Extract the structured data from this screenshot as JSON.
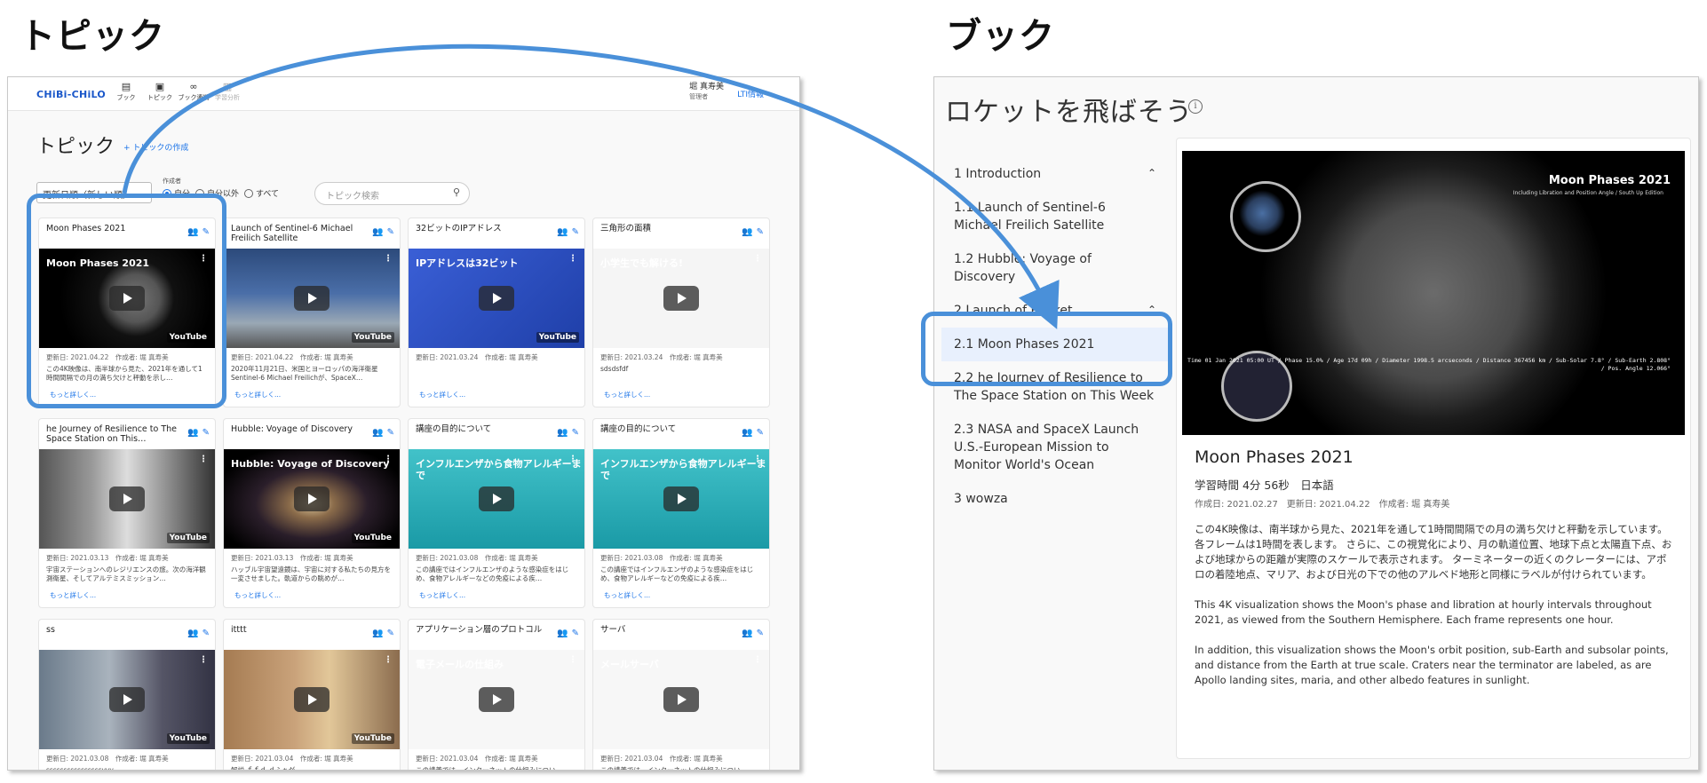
{
  "labels": {
    "left": "トピック",
    "right": "ブック"
  },
  "app": {
    "logo": "CHiBi-CHiLO",
    "nav": [
      {
        "label": "ブック",
        "icon": "book-icon"
      },
      {
        "label": "トピック",
        "icon": "topics-icon"
      },
      {
        "label": "ブック連携",
        "icon": "link-icon"
      },
      {
        "label": "学習分析",
        "icon": "chart-icon"
      }
    ],
    "user_name": "堀 真寿美",
    "user_role": "管理者",
    "lti": "LTI情報"
  },
  "topics_page": {
    "title": "トピック",
    "create": "+ トピックの作成",
    "sort": "更新日順（新しい順）",
    "creator_label": "作成者",
    "filters": [
      "自分",
      "自分以外",
      "すべて"
    ],
    "search_placeholder": "トピック検索",
    "more": "もっと詳しく...",
    "cards": [
      {
        "title": "Moon Phases 2021",
        "meta": "更新日: 2021.04.22　作成者: 堀 真寿美",
        "desc": "この4K映像は、南半球から見た、2021年を通して1時間間隔での月の満ち欠けと秤動を示し…",
        "thumb": "t-moon",
        "thumb_text": "Moon Phases 2021",
        "youtube": "YouTube"
      },
      {
        "title": "Launch of Sentinel-6 Michael Freilich Satellite",
        "meta": "更新日: 2021.04.22　作成者: 堀 真寿美",
        "desc": "2020年11月21日、米国とヨーロッパの海洋衛星Sentinel-6 Michael Freilichが、SpaceX…",
        "thumb": "t-rocket",
        "thumb_text": "",
        "youtube": "YouTube"
      },
      {
        "title": "32ビットのIPアドレス",
        "meta": "更新日: 2021.03.24　作成者: 堀 真寿美",
        "desc": "",
        "thumb": "t-ip",
        "thumb_text": "IPアドレスは32ビット",
        "youtube": "YouTube"
      },
      {
        "title": "三角形の面積",
        "meta": "更新日: 2021.03.24　作成者: 堀 真寿美",
        "desc": "sdsdsfdf",
        "thumb": "t-tri",
        "thumb_text": "小学生でも解ける!",
        "youtube": ""
      },
      {
        "title": "he Journey of Resilience to The Space Station on This…",
        "meta": "更新日: 2021.03.13　作成者: 堀 真寿美",
        "desc": "宇宙ステーションへのレジリエンスの旅。次の海洋観測衛星、そしてアルテミスミッション…",
        "thumb": "t-astro",
        "thumb_text": "",
        "youtube": "YouTube"
      },
      {
        "title": "Hubble: Voyage of Discovery",
        "meta": "更新日: 2021.03.13　作成者: 堀 真寿美",
        "desc": "ハッブル宇宙望遠鏡は、宇宙に対する私たちの見方を一変させました。軌道からの眺めが…",
        "thumb": "t-galaxy",
        "thumb_text": "Hubble: Voyage of Discovery",
        "youtube": "YouTube"
      },
      {
        "title": "講座の目的について",
        "meta": "更新日: 2021.03.08　作成者: 堀 真寿美",
        "desc": "この講座ではインフルエンザのような感染症をはじめ、食物アレルギーなどの免疫による疾…",
        "thumb": "t-teal",
        "thumb_text": "インフルエンザから食物アレルギーまで",
        "youtube": ""
      },
      {
        "title": "講座の目的について",
        "meta": "更新日: 2021.03.08　作成者: 堀 真寿美",
        "desc": "この講座ではインフルエンザのような感染症をはじめ、食物アレルギーなどの免疫による疾…",
        "thumb": "t-teal",
        "thumb_text": "インフルエンザから食物アレルギーまで",
        "youtube": ""
      },
      {
        "title": "ss",
        "meta": "更新日: 2021.03.08　作成者: 堀 真寿美",
        "desc": "ssssssssssssssssvvv",
        "thumb": "t-people",
        "thumb_text": "",
        "youtube": "YouTube"
      },
      {
        "title": "itttt",
        "meta": "更新日: 2021.03.04　作成者: 堀 真寿美",
        "desc": "解説 ｆｆｄ ｄふぁが",
        "thumb": "t-dog",
        "thumb_text": "",
        "youtube": "YouTube"
      },
      {
        "title": "アプリケーション層のプロトコル",
        "meta": "更新日: 2021.03.04　作成者: 堀 真寿美",
        "desc": "この講義では、インターネットの仕組みについ…",
        "thumb": "t-net",
        "thumb_text": "電子メールの仕組み",
        "youtube": ""
      },
      {
        "title": "サーバ",
        "meta": "更新日: 2021.03.04　作成者: 堀 真寿美",
        "desc": "この講義では、インターネットの仕組みについ…",
        "thumb": "t-net",
        "thumb_text": "メールサーバ",
        "youtube": ""
      }
    ]
  },
  "book_page": {
    "title": "ロケットを飛ばそう",
    "toc": [
      {
        "label": "1 Introduction",
        "expanded": true
      },
      {
        "label": "1.1 Launch of Sentinel-6 Michael Freilich Satellite"
      },
      {
        "label": "1.2 Hubble: Voyage of Discovery"
      },
      {
        "label": "2 Launch of Rocket",
        "expanded": true
      },
      {
        "label": "2.1 Moon Phases 2021",
        "selected": true
      },
      {
        "label": "2.2 he Journey of Resilience to The Space Station on This Week"
      },
      {
        "label": "2.3 NASA and SpaceX Launch U.S.-European Mission to Monitor World's Ocean"
      },
      {
        "label": "3 wowza"
      }
    ],
    "content": {
      "video_title": "Moon Phases 2021",
      "video_subtitle": "Including Libration and Position Angle / South Up Edition",
      "video_stats": "Time 01 Jan 2021 05:00 UT / Phase 15.0% / Age 17d 09h / Diameter 1998.5 arcseconds / Distance 367456 km / Sub-Solar 7.8° / Sub-Earth 2.808° / Pos. Angle 12.066°",
      "title": "Moon Phases 2021",
      "duration": "学習時間 4分 56秒　日本語",
      "dates": "作成日: 2021.02.27　更新日: 2021.04.22　作成者: 堀 真寿美",
      "paragraphs": [
        "この4K映像は、南半球から見た、2021年を通して1時間間隔での月の満ち欠けと秤動を示しています。各フレームは1時間を表します。 さらに、この視覚化により、月の軌道位置、地球下点と太陽直下点、および地球からの距離が実際のスケールで表示されます。 ターミネーターの近くのクレーターには、アポロの着陸地点、マリア、および日光の下での他のアルベド地形と同様にラベルが付けられています。",
        "This 4K visualization shows the Moon's phase and libration at hourly intervals throughout 2021, as viewed from the Southern Hemisphere. Each frame represents one hour.",
        "In addition, this visualization shows the Moon's orbit position, sub-Earth and subsolar points, and distance from the Earth at true scale. Craters near the terminator are labeled, as are Apollo landing sites, maria, and other albedo features in sunlight."
      ]
    }
  },
  "colors": {
    "accent": "#1a73e8",
    "annotation": "#4a90d9",
    "selected_bg": "#e8f0fd"
  }
}
